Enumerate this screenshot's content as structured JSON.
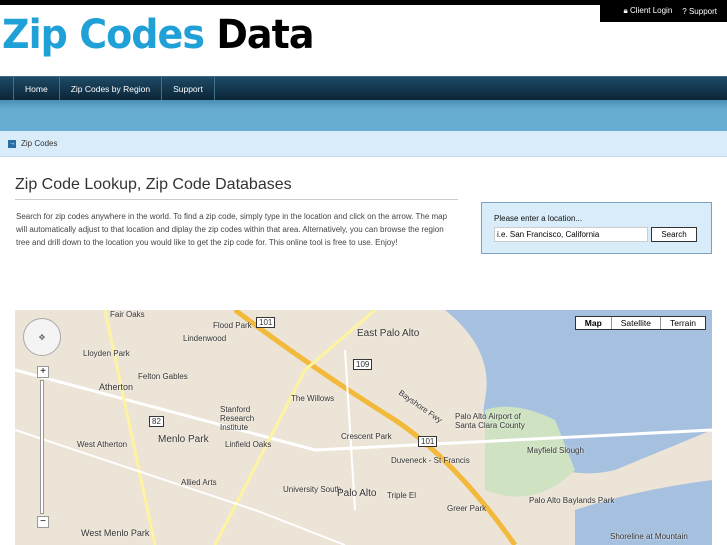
{
  "header": {
    "logo_part1": "Zip Codes",
    "logo_part2": "Data",
    "client_login": "Client Login",
    "support": "Support"
  },
  "nav": {
    "items": [
      {
        "label": "Home"
      },
      {
        "label": "Zip Codes by Region"
      },
      {
        "label": "Support"
      }
    ]
  },
  "breadcrumb": {
    "label": "Zip Codes"
  },
  "main": {
    "title": "Zip Code Lookup, Zip Code Databases",
    "intro": "Search for zip codes anywhere in the world. To find a zip code, simply type in the location and click on the arrow. The map will automatically adjust to that location and diplay the zip codes within that area. Alternatively, you can browse the region tree and drill down to the location you would like to get the zip code for. This online tool is free to use. Enjoy!"
  },
  "search": {
    "label": "Please enter a location...",
    "value": "i.e. San Francisco, California",
    "button": "Search"
  },
  "map": {
    "types": [
      "Map",
      "Satellite",
      "Terrain"
    ],
    "labels": [
      "Fair Oaks",
      "Flood Park",
      "Lindenwood",
      "East Palo Alto",
      "Lloyden Park",
      "Atherton",
      "Felton Gables",
      "The Willows",
      "Stanford Research Institute",
      "Menlo Park",
      "Linfield Oaks",
      "Crescent Park",
      "West Atherton",
      "Allied Arts",
      "University South",
      "Palo Alto",
      "Triple El",
      "Duveneck - St Francis",
      "Greer Park",
      "Palo Alto Airport of Santa Clara County",
      "Mayfield Slough",
      "Palo Alto Baylands Park",
      "West Menlo Park",
      "Shoreline at Mountain",
      "Bayshore Fwy"
    ],
    "shields": [
      "101",
      "109",
      "82",
      "101"
    ]
  }
}
